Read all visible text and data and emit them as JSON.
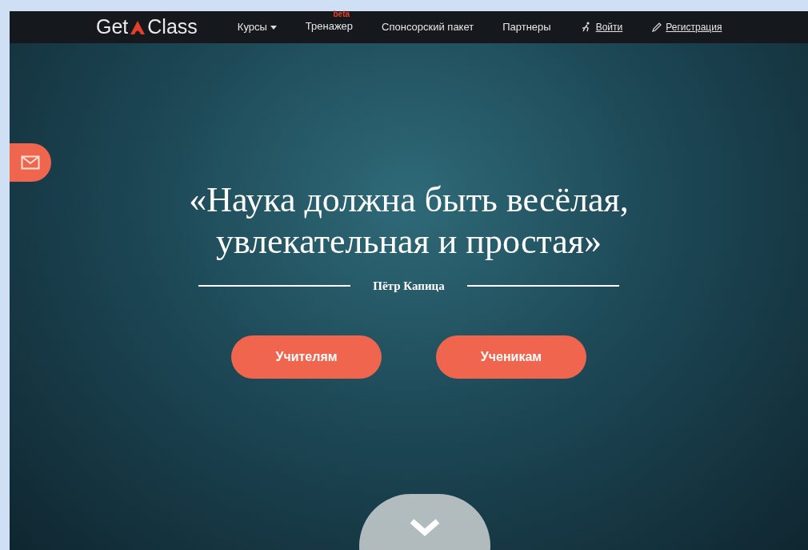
{
  "logo": {
    "left": "Get",
    "right": "Class"
  },
  "nav": [
    {
      "label": "Курсы",
      "kind": "dropdown"
    },
    {
      "label": "Тренажер",
      "kind": "badge",
      "badge": "beta"
    },
    {
      "label": "Спонсорский пакет",
      "kind": "plain"
    },
    {
      "label": "Партнеры",
      "kind": "plain"
    },
    {
      "label": "Войти",
      "kind": "login"
    },
    {
      "label": "Регистрация",
      "kind": "register"
    }
  ],
  "hero": {
    "quote": "«Наука должна быть весёлая, увлекательная и простая»",
    "author": "Пётр Капица"
  },
  "buttons": [
    "Учителям",
    "Ученикам"
  ]
}
